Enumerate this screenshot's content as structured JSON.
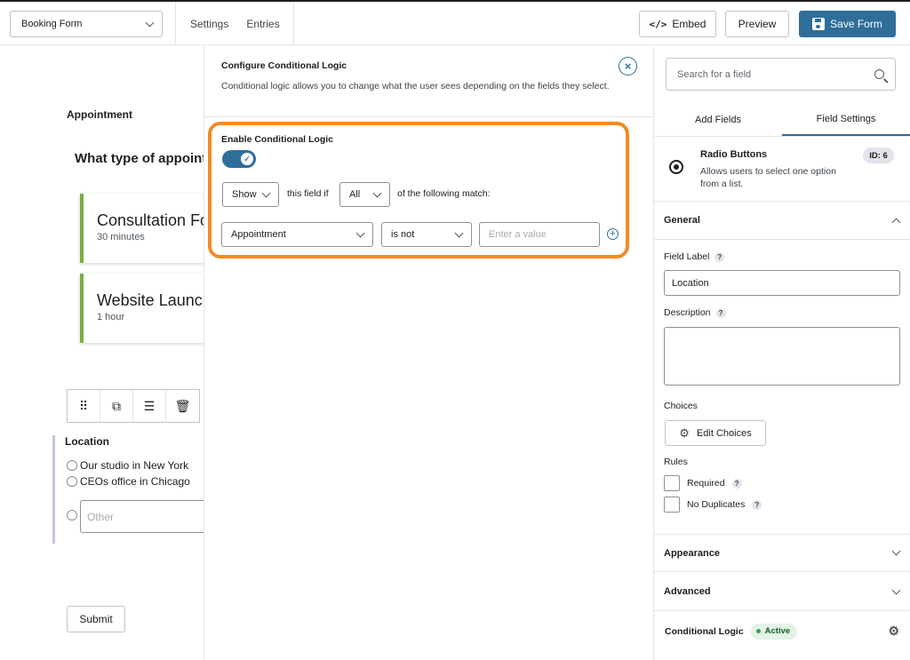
{
  "topbar": {
    "form_select": "Booking Form",
    "nav": [
      "Settings",
      "Entries"
    ],
    "embed_label": "Embed",
    "embed_icon": "</>",
    "preview_label": "Preview",
    "save_label": "Save Form"
  },
  "canvas": {
    "section_title": "Appointment",
    "question": "What type of appointment",
    "choices": [
      {
        "title": "Consultation Form",
        "sub": "30 minutes"
      },
      {
        "title": "Website Launch",
        "sub": "1 hour"
      }
    ],
    "toolbar_icons": [
      "drag-handle-icon",
      "duplicate-icon",
      "settings-sliders-icon",
      "trash-icon"
    ],
    "location": {
      "title": "Location",
      "options": [
        "Our studio in New York",
        "CEOs office in Chicago"
      ],
      "other_placeholder": "Other"
    },
    "submit_label": "Submit"
  },
  "conditional_logic": {
    "title": "Configure Conditional Logic",
    "description": "Conditional logic allows you to change what the user sees depending on the fields they select.",
    "enable_label": "Enable Conditional Logic",
    "enabled": true,
    "action": "Show",
    "text_this_field_if": "this field if",
    "match_type": "All",
    "text_following_match": "of the following match:",
    "rule": {
      "field": "Appointment",
      "operator": "is not",
      "value_placeholder": "Enter a value"
    },
    "highlight_color": "#f28b24"
  },
  "sidebar": {
    "search_placeholder": "Search for a field",
    "tabs": [
      "Add Fields",
      "Field Settings"
    ],
    "active_tab": "Field Settings",
    "field_type": "Radio Buttons",
    "field_type_desc": "Allows users to select one option from a list.",
    "field_id": "ID: 6",
    "general_label": "General",
    "field_label_label": "Field Label",
    "field_label_value": "Location",
    "description_label": "Description",
    "description_value": "",
    "choices_label": "Choices",
    "edit_choices_label": "Edit Choices",
    "rules_label": "Rules",
    "rules": [
      {
        "label": "Required",
        "checked": false
      },
      {
        "label": "No Duplicates",
        "checked": false
      }
    ],
    "appearance_label": "Appearance",
    "advanced_label": "Advanced",
    "conditional_logic_label": "Conditional Logic",
    "conditional_logic_status": "Active",
    "accent_color": "#2f6e98"
  }
}
